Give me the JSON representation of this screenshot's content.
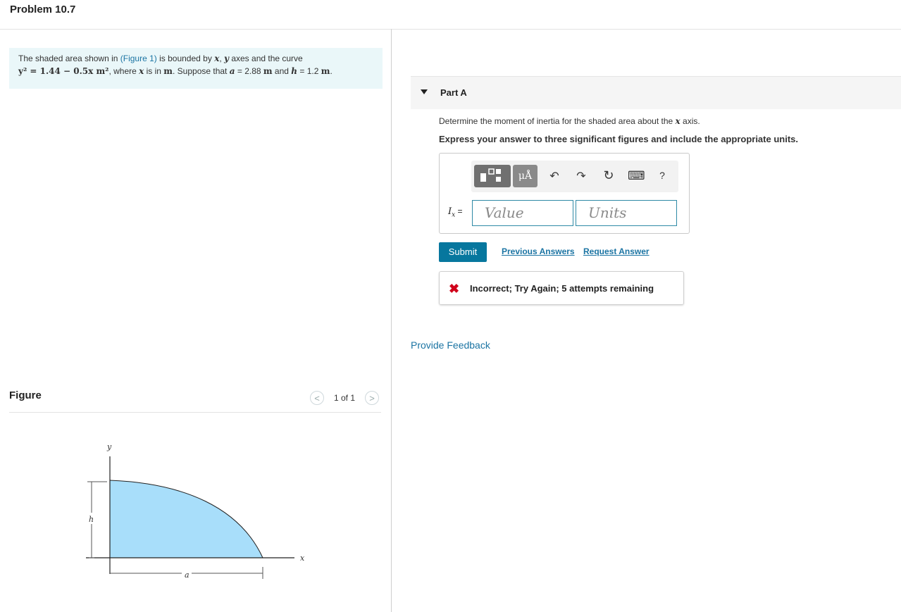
{
  "header": {
    "title": "Problem 10.7"
  },
  "problem": {
    "t1": "The shaded area shown in ",
    "figure_link": "(Figure 1)",
    "t2": " is bounded by ",
    "x": "x",
    "comma": ", ",
    "y": "y",
    "t3": " axes and the curve",
    "equation": "y² = 1.44 − 0.5x m²",
    "t4": ", where ",
    "t5": " is in ",
    "m": "m",
    "t6": ". Suppose that ",
    "a": "a",
    "t7": " = 2.88 ",
    "t8": " and ",
    "h": "h",
    "t9": " = 1.2 ",
    "t10": "."
  },
  "figure": {
    "label": "Figure",
    "counter": "1 of 1",
    "prev": "<",
    "next": ">",
    "axis_y": "y",
    "axis_x": "x",
    "dim_h": "h",
    "dim_a": "a",
    "fill_color": "#a8defa"
  },
  "part": {
    "label": "Part A",
    "question": "Determine the moment of inertia for the shaded area about the ",
    "question_var": "x",
    "question_end": " axis.",
    "instruction": "Express your answer to three significant figures and include the appropriate units."
  },
  "answer": {
    "var": "I",
    "sub": "x",
    "eq": " =",
    "value_placeholder": "Value",
    "units_placeholder": "Units",
    "toolbar": {
      "units_btn": "μÅ",
      "undo": "↶",
      "redo": "↷",
      "reset": "↻",
      "keyboard": "⌨",
      "help": "?"
    }
  },
  "actions": {
    "submit": "Submit",
    "previous_answers": "Previous Answers",
    "request_answer": "Request Answer"
  },
  "feedback": {
    "icon": "✖",
    "text": "Incorrect; Try Again; 5 attempts remaining"
  },
  "provide_feedback": "Provide Feedback",
  "colors": {
    "accent": "#07779e",
    "link": "#1b74a3",
    "error": "#d0021b",
    "problem_bg": "#eaf7f9"
  }
}
